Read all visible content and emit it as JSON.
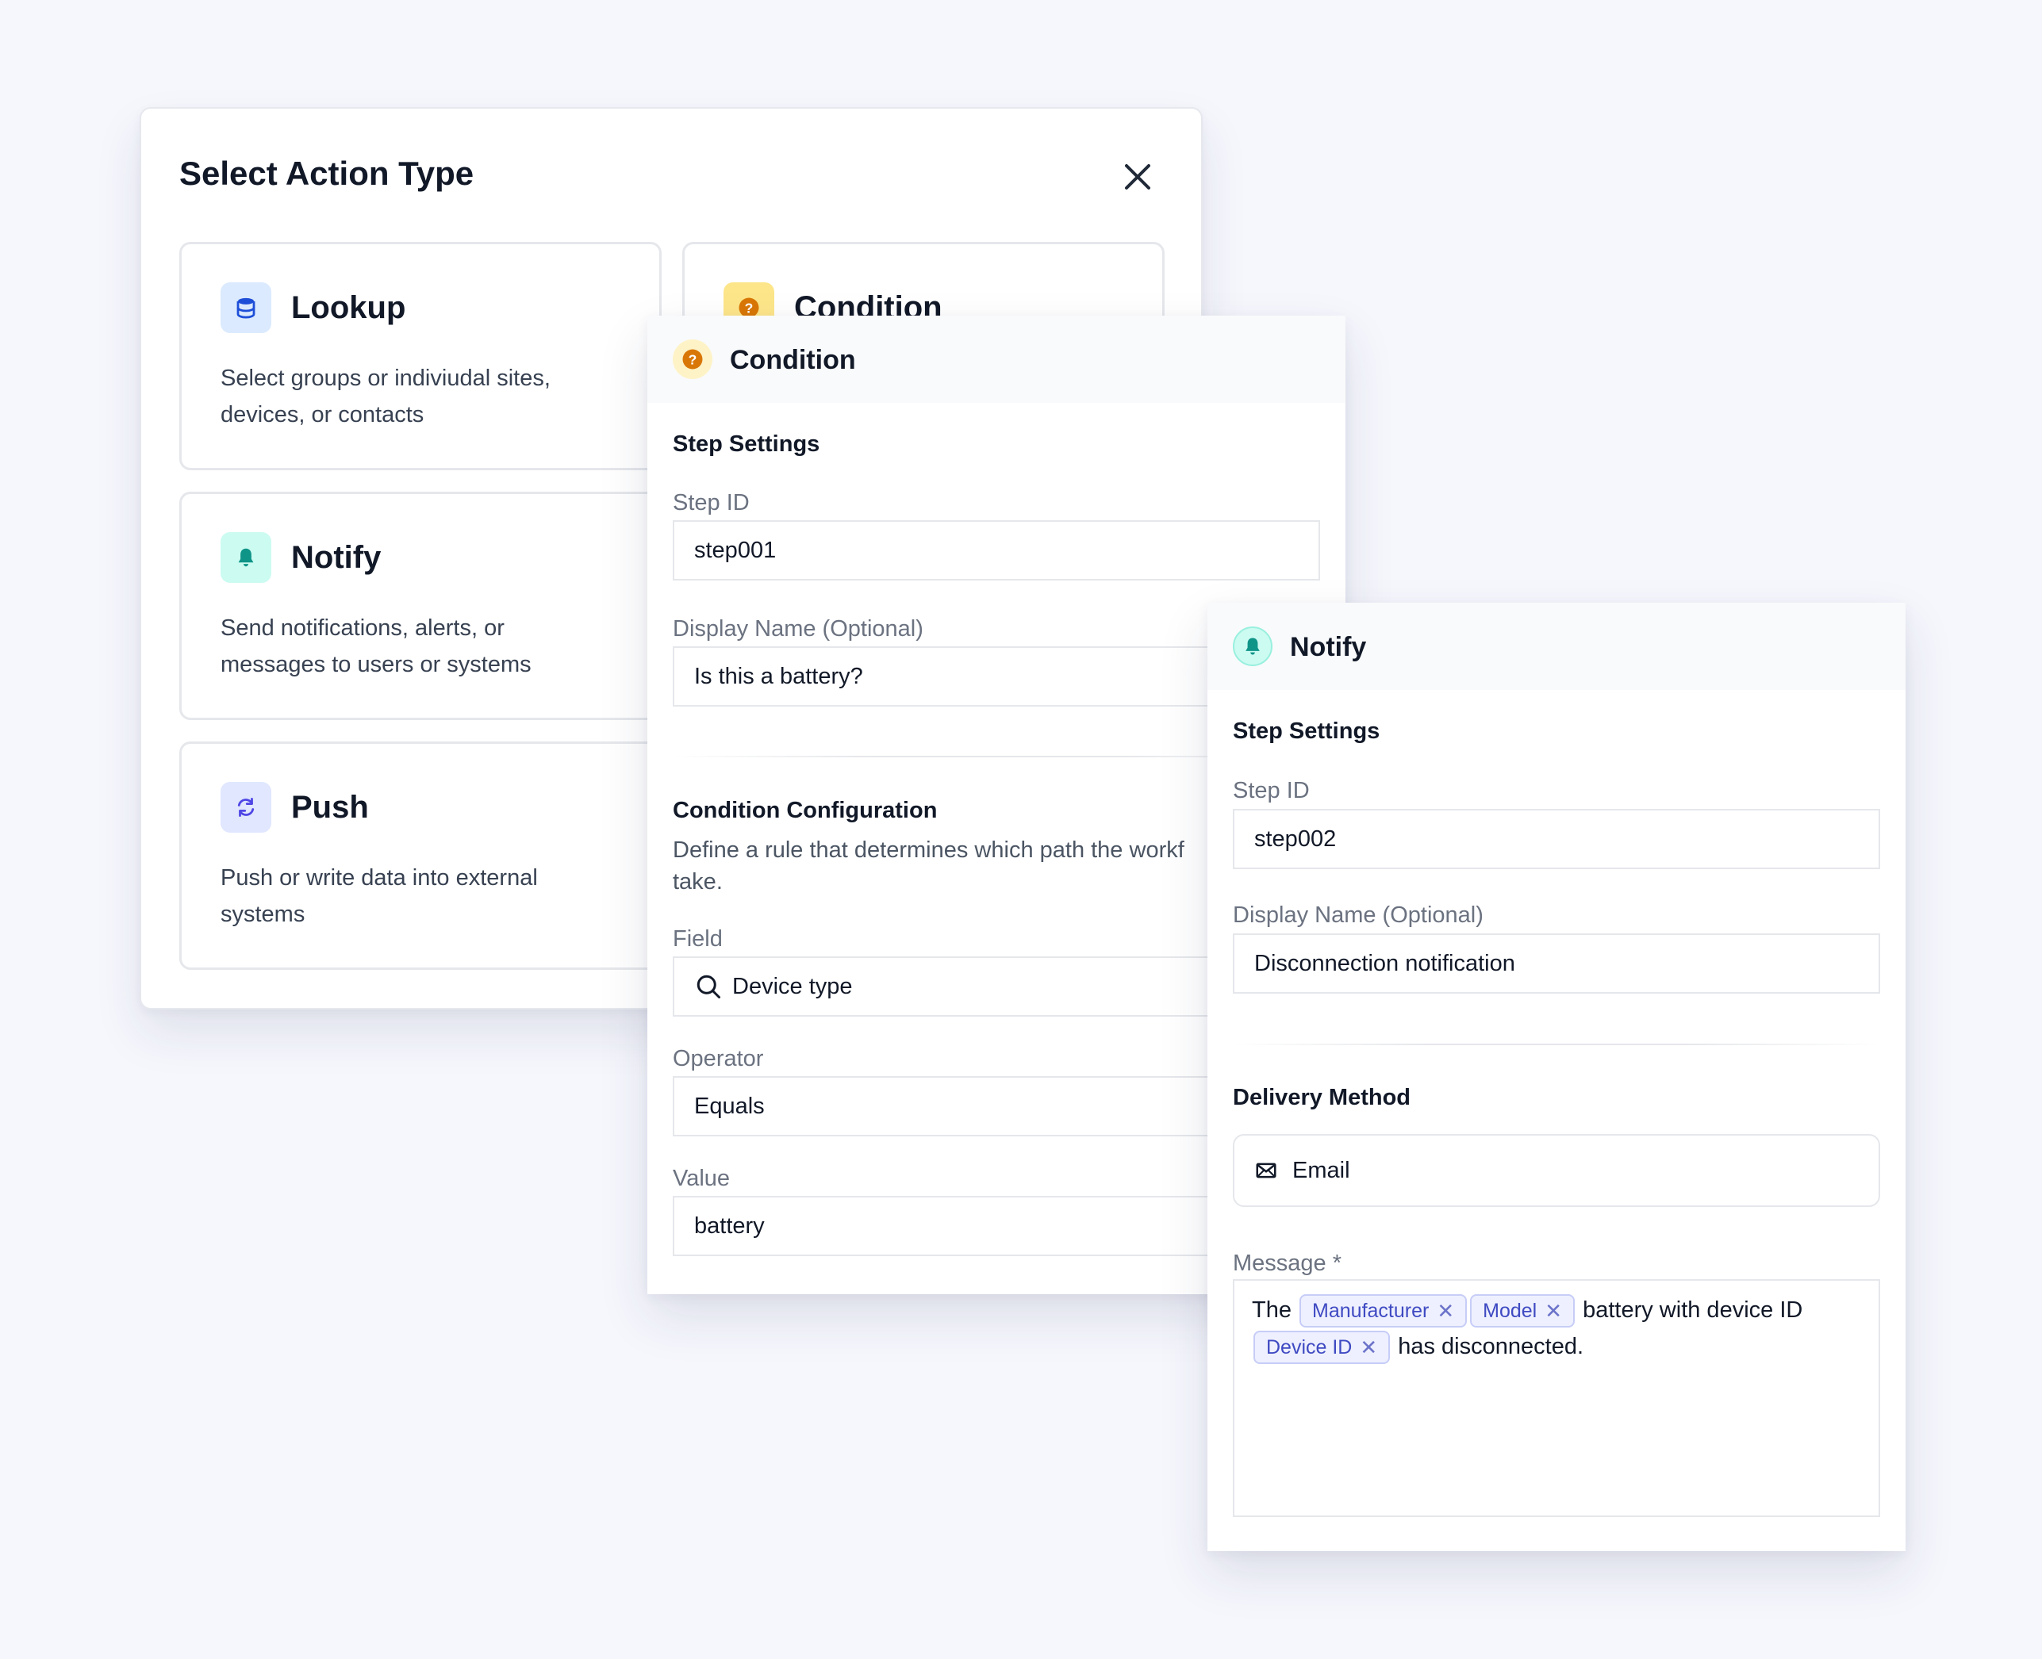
{
  "modal": {
    "title": "Select Action Type",
    "cards": [
      {
        "title": "Lookup",
        "desc": "Select groups or indiviudal sites, devices, or contacts",
        "icon": "database-icon",
        "tile_color": "#dbeafe",
        "icon_color": "#1d4ed8"
      },
      {
        "title": "Condition",
        "icon": "question-icon",
        "tile_color": "#fde68a",
        "icon_color": "#d97706"
      },
      {
        "title": "Notify",
        "desc": "Send notifications, alerts, or messages to users or systems",
        "icon": "bell-icon",
        "tile_color": "#ccfbf1",
        "icon_color": "#0f9488"
      },
      {
        "title": "Push",
        "desc": "Push or write data into external systems",
        "icon": "sync-icon",
        "tile_color": "#e0e7ff",
        "icon_color": "#4f46e5"
      }
    ]
  },
  "condition_panel": {
    "title": "Condition",
    "step_settings_title": "Step Settings",
    "step_id_label": "Step ID",
    "step_id_value": "step001",
    "display_name_label": "Display Name (Optional)",
    "display_name_value": "Is this a battery?",
    "config_title": "Condition Configuration",
    "config_helper_line1": "Define a rule that determines which path the workf",
    "config_helper_line2": "take.",
    "field_label": "Field",
    "field_value": "Device type",
    "operator_label": "Operator",
    "operator_value": "Equals",
    "value_label": "Value",
    "value_value": "battery"
  },
  "notify_panel": {
    "title": "Notify",
    "step_settings_title": "Step Settings",
    "step_id_label": "Step ID",
    "step_id_value": "step002",
    "display_name_label": "Display Name (Optional)",
    "display_name_value": "Disconnection notification",
    "delivery_title": "Delivery Method",
    "delivery_value": "Email",
    "message_label": "Message *",
    "message": {
      "text_1": "The",
      "chip_1": "Manufacturer",
      "chip_2": "Model",
      "text_2": "battery with device ID",
      "chip_3": "Device ID",
      "text_3": "has disconnected."
    }
  }
}
